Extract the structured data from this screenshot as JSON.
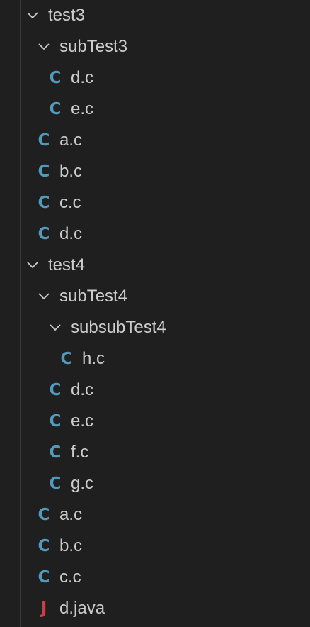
{
  "colors": {
    "background": "#1f1f1f",
    "text": "#cccccc",
    "c_icon": "#519aba",
    "java_icon": "#cc3e44",
    "indent_guide": "#3a3a3a"
  },
  "icons": {
    "folder_expanded": "chevron-down-icon",
    "c_file": "c-file-icon",
    "java_file": "java-file-icon",
    "c_glyph": "C",
    "java_glyph": "J"
  },
  "tree": [
    {
      "label": "test3",
      "kind": "folder",
      "depth": 0,
      "expanded": true
    },
    {
      "label": "subTest3",
      "kind": "folder",
      "depth": 1,
      "expanded": true
    },
    {
      "label": "d.c",
      "kind": "c",
      "depth": 2
    },
    {
      "label": "e.c",
      "kind": "c",
      "depth": 2
    },
    {
      "label": "a.c",
      "kind": "c",
      "depth": 1
    },
    {
      "label": "b.c",
      "kind": "c",
      "depth": 1
    },
    {
      "label": "c.c",
      "kind": "c",
      "depth": 1
    },
    {
      "label": "d.c",
      "kind": "c",
      "depth": 1
    },
    {
      "label": "test4",
      "kind": "folder",
      "depth": 0,
      "expanded": true
    },
    {
      "label": "subTest4",
      "kind": "folder",
      "depth": 1,
      "expanded": true
    },
    {
      "label": "subsubTest4",
      "kind": "folder",
      "depth": 2,
      "expanded": true
    },
    {
      "label": "h.c",
      "kind": "c",
      "depth": 3
    },
    {
      "label": "d.c",
      "kind": "c",
      "depth": 2
    },
    {
      "label": "e.c",
      "kind": "c",
      "depth": 2
    },
    {
      "label": "f.c",
      "kind": "c",
      "depth": 2
    },
    {
      "label": "g.c",
      "kind": "c",
      "depth": 2
    },
    {
      "label": "a.c",
      "kind": "c",
      "depth": 1
    },
    {
      "label": "b.c",
      "kind": "c",
      "depth": 1
    },
    {
      "label": "c.c",
      "kind": "c",
      "depth": 1
    },
    {
      "label": "d.java",
      "kind": "java",
      "depth": 1
    }
  ]
}
